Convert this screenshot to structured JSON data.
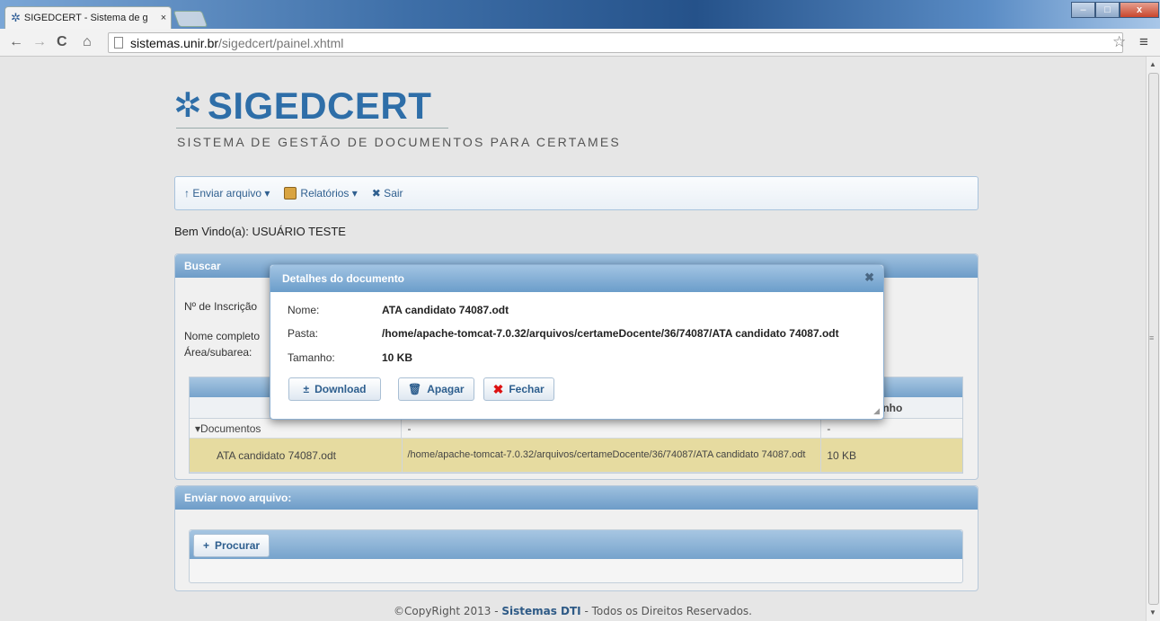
{
  "browser": {
    "tab_title": "SIGEDCERT - Sistema de g",
    "tab_close": "×",
    "back": "←",
    "forward": "→",
    "reload": "C",
    "home": "⌂",
    "url_host": "sistemas.unir.br",
    "url_path": "/sigedcert/painel.xhtml",
    "star": "☆",
    "menu": "≡",
    "win_min": "–",
    "win_max": "□",
    "win_close": "x"
  },
  "header": {
    "logo_mark": "✲",
    "logo": "SIGEDCERT",
    "subtitle": "SISTEMA DE GESTÃO DE DOCUMENTOS PARA CERTAMES"
  },
  "menubar": {
    "enviar_arquivo": "↑ Enviar arquivo ▾",
    "relatorios": "Relatórios ▾",
    "sair": "✖ Sair"
  },
  "welcome": "Bem Vindo(a): USUÁRIO TESTE",
  "buscar": {
    "title": "Buscar",
    "label_inscricao": "Nº de Inscrição",
    "label_nome": "Nome completo",
    "label_area": "Área/subarea:"
  },
  "table": {
    "columns": [
      "",
      "",
      "Tamanho"
    ],
    "col_visible_fragment": "nanho",
    "group": {
      "name": "Documentos",
      "toggle": "▾",
      "path": "-",
      "size": "-"
    },
    "rows": [
      {
        "name": "ATA candidato 74087.odt",
        "path": "/home/apache-tomcat-7.0.32/arquivos/certameDocente/36/74087/ATA candidato 74087.odt",
        "size": "10 KB"
      }
    ]
  },
  "enviar": {
    "title": "Enviar novo arquivo:",
    "procurar": "Procurar",
    "plus": "+"
  },
  "dialog": {
    "title": "Detalhes do documento",
    "close": "✖",
    "fields": [
      {
        "label": "Nome:",
        "value": "ATA candidato 74087.odt"
      },
      {
        "label": "Pasta:",
        "value": "/home/apache-tomcat-7.0.32/arquivos/certameDocente/36/74087/ATA candidato 74087.odt"
      },
      {
        "label": "Tamanho:",
        "value": "10 KB"
      }
    ],
    "btn_download": "Download",
    "btn_download_icon": "±",
    "btn_apagar": "Apagar",
    "btn_apagar_icon": "🗑",
    "btn_fechar": "Fechar",
    "btn_fechar_icon": "✖"
  },
  "footer": {
    "prefix": "©CopyRight 2013 - ",
    "brand": "Sistemas DTI",
    "suffix": " - Todos os Direitos Reservados."
  },
  "colors": {
    "accent": "#2e6ea8",
    "panel_header": "#6d9cc8",
    "selected_row": "#e6dba0"
  }
}
